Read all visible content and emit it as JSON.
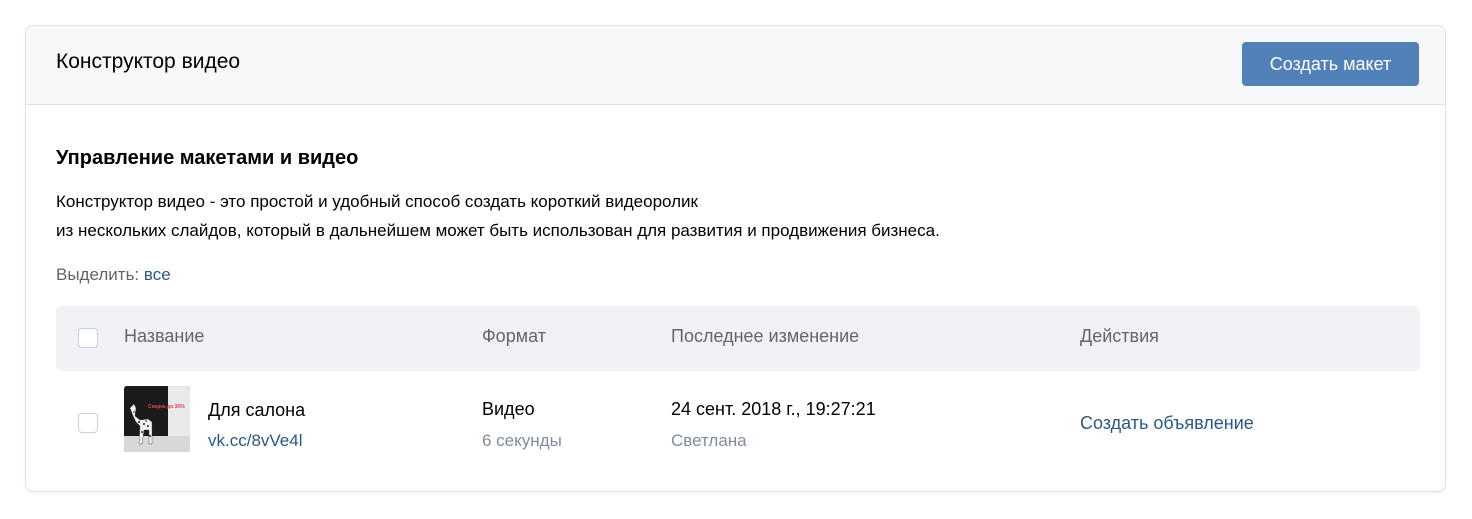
{
  "header": {
    "title": "Конструктор видео",
    "create_button": "Создать макет"
  },
  "section": {
    "title": "Управление макетами и видео",
    "description_line1": "Конструктор видео - это простой и удобный способ создать короткий видеоролик",
    "description_line2": "из нескольких слайдов, который в дальнейшем может быть использован для развития и продвижения бизнеса."
  },
  "select": {
    "label": "Выделить:",
    "all_link": "все"
  },
  "table": {
    "columns": [
      "Название",
      "Формат",
      "Последнее изменение",
      "Действия"
    ],
    "rows": [
      {
        "name": "Для салона",
        "short_link": "vk.cc/8vVe4l",
        "thumb_text": "Скидка до 30%",
        "format": "Видео",
        "duration": "6 секунды",
        "modified": "24 сент. 2018 г., 19:27:21",
        "author": "Светлана",
        "action": "Создать объявление"
      }
    ]
  },
  "colors": {
    "accent": "#5181b8",
    "link": "#2a5885",
    "header_bg": "#f7f8fa",
    "table_head_bg": "#f0f2f5"
  }
}
